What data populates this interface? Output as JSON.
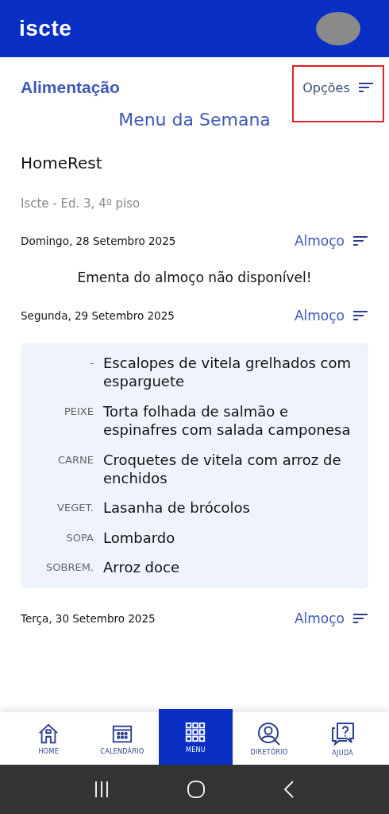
{
  "header": {
    "logo": "iscte"
  },
  "page": {
    "title": "Alimentação",
    "options_label": "Opções",
    "subtitle": "Menu da Semana"
  },
  "restaurant": {
    "name": "HomeRest",
    "location": "Iscte - Ed. 3, 4º piso"
  },
  "days": [
    {
      "date": "Domingo, 28 Setembro 2025",
      "meal": "Almoço",
      "message": "Ementa do almoço não disponível!"
    },
    {
      "date": "Segunda, 29 Setembro 2025",
      "meal": "Almoço",
      "dishes": [
        {
          "category": "-",
          "name": "Escalopes de vitela grelhados com esparguete"
        },
        {
          "category": "PEIXE",
          "name": "Torta folhada de salmão e espinafres com salada camponesa"
        },
        {
          "category": "CARNE",
          "name": "Croquetes de vitela com arroz de enchidos"
        },
        {
          "category": "VEGET.",
          "name": "Lasanha de brócolos"
        },
        {
          "category": "SOPA",
          "name": "Lombardo"
        },
        {
          "category": "SOBREM.",
          "name": "Arroz doce"
        }
      ]
    },
    {
      "date": "Terça, 30 Setembro 2025",
      "meal": "Almoço"
    }
  ],
  "nav": [
    {
      "label": "HOME",
      "kind": "home",
      "selected": false
    },
    {
      "label": "CALENDÁRIO",
      "kind": "calendar",
      "selected": false
    },
    {
      "label": "MENU",
      "kind": "grid",
      "selected": true
    },
    {
      "label": "DIRETÓRIO",
      "kind": "directory",
      "selected": false
    },
    {
      "label": "AJUDA",
      "kind": "help",
      "selected": false
    }
  ]
}
